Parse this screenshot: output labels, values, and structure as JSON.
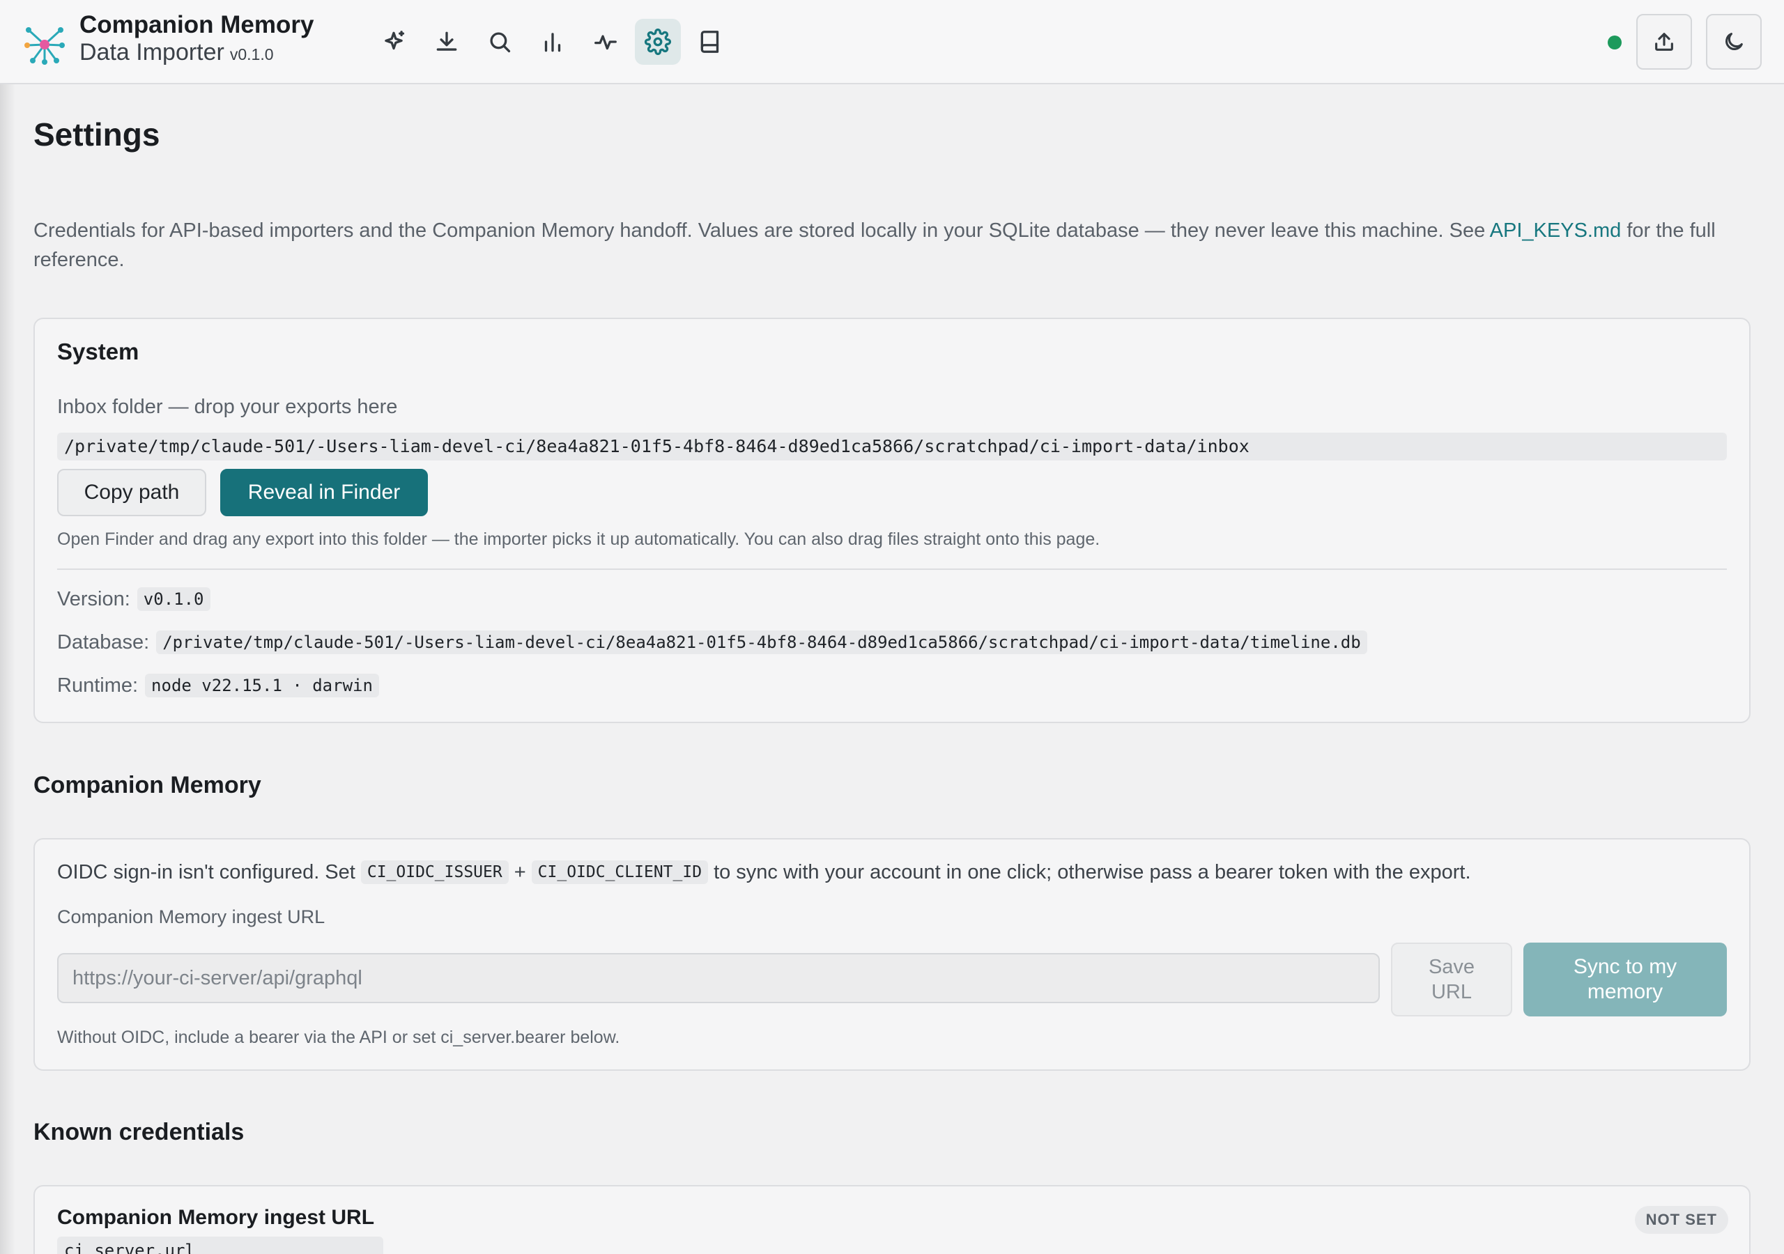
{
  "app": {
    "title": "Companion Memory",
    "subtitle": "Data Importer",
    "version": "v0.1.0"
  },
  "nav": [
    {
      "name": "sparkles",
      "icon": "sparkles-icon",
      "active": false
    },
    {
      "name": "import",
      "icon": "download-icon",
      "active": false
    },
    {
      "name": "search",
      "icon": "search-icon",
      "active": false
    },
    {
      "name": "stats",
      "icon": "bar-chart-icon",
      "active": false
    },
    {
      "name": "activity",
      "icon": "activity-icon",
      "active": false
    },
    {
      "name": "settings",
      "icon": "gear-icon",
      "active": true
    },
    {
      "name": "docs",
      "icon": "book-icon",
      "active": false
    }
  ],
  "header_right": {
    "status_color": "#1d9a5c",
    "export_icon": "upload-icon",
    "theme_icon": "moon-icon"
  },
  "page": {
    "title": "Settings",
    "intro_text": "Credentials for API-based importers and the Companion Memory handoff. Values are stored locally in your SQLite database — they never leave this machine. See ",
    "intro_link": "API_KEYS.md",
    "intro_tail": " for the full reference."
  },
  "system": {
    "heading": "System",
    "inbox_label": "Inbox folder — drop your exports here",
    "inbox_path": "/private/tmp/claude-501/-Users-liam-devel-ci/8ea4a821-01f5-4bf8-8464-d89ed1ca5866/scratchpad/ci-import-data/inbox",
    "copy_button": "Copy path",
    "reveal_button": "Reveal in Finder",
    "hint": "Open Finder and drag any export into this folder — the importer picks it up automatically. You can also drag files straight onto this page.",
    "version_label": "Version:",
    "version_value": "v0.1.0",
    "database_label": "Database:",
    "database_value": "/private/tmp/claude-501/-Users-liam-devel-ci/8ea4a821-01f5-4bf8-8464-d89ed1ca5866/scratchpad/ci-import-data/timeline.db",
    "runtime_label": "Runtime:",
    "runtime_value": "node v22.15.1 · darwin"
  },
  "companion": {
    "heading": "Companion Memory",
    "oidc_pre": "OIDC sign-in isn't configured. Set",
    "oidc_var1": "CI_OIDC_ISSUER",
    "oidc_plus": "+",
    "oidc_var2": "CI_OIDC_CLIENT_ID",
    "oidc_post": "to sync with your account in one click; otherwise pass a bearer token with the export.",
    "url_label": "Companion Memory ingest URL",
    "url_value": "",
    "url_placeholder": "https://your-ci-server/api/graphql",
    "save_line1": "Save",
    "save_line2": "URL",
    "sync_line1": "Sync to my",
    "sync_line2": "memory",
    "hint": "Without OIDC, include a bearer via the API or set ci_server.bearer below."
  },
  "credentials": {
    "heading": "Known credentials",
    "items": [
      {
        "title": "Companion Memory ingest URL",
        "key": "ci_server.url",
        "status": "NOT SET"
      }
    ]
  }
}
